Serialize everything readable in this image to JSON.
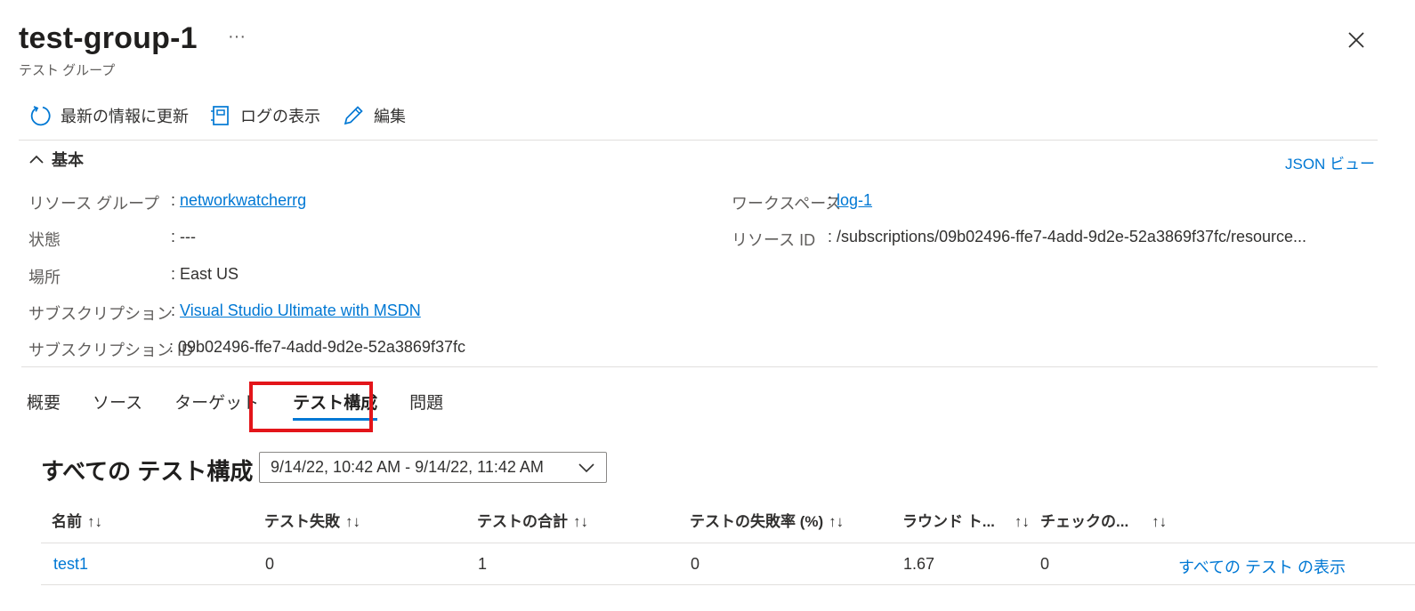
{
  "header": {
    "title": "test-group-1",
    "more_label": "···",
    "subtitle": "テスト グループ"
  },
  "toolbar": {
    "refresh_label": "最新の情報に更新",
    "logs_label": "ログの表示",
    "edit_label": "編集"
  },
  "essentials": {
    "section_label": "基本",
    "json_view_label": "JSON ビュー",
    "left": [
      {
        "label": "リソース グループ",
        "value": "networkwatcherrg"
      },
      {
        "label": "状態",
        "value": "---"
      },
      {
        "label": "場所",
        "value": "East US"
      },
      {
        "label": "サブスクリプション",
        "value": "Visual Studio Ultimate with MSDN"
      },
      {
        "label": "サブスクリプション ID",
        "value": "09b02496-ffe7-4add-9d2e-52a3869f37fc"
      }
    ],
    "right": [
      {
        "label": "ワークスペース",
        "value": "log-1"
      },
      {
        "label": "リソース ID",
        "value": "/subscriptions/09b02496-ffe7-4add-9d2e-52a3869f37fc/resource..."
      }
    ]
  },
  "tabs": [
    "概要",
    "ソース",
    "ターゲット",
    "テスト構成",
    "問題"
  ],
  "active_tab": "テスト構成",
  "test_config": {
    "title": "すべての テスト構成",
    "date_range": "9/14/22, 10:42 AM - 9/14/22, 11:42 AM",
    "columns": [
      "名前",
      "テスト失敗",
      "テストの合計",
      "テストの失敗率 (%)",
      "ラウンド ト...",
      "チェックの..."
    ],
    "sort_glyph": "↑↓",
    "rows": [
      {
        "name": "test1",
        "failed": "0",
        "total": "1",
        "fail_rate": "0",
        "round_trip": "1.67",
        "checks": "0",
        "action": "すべての テスト の表示"
      }
    ]
  },
  "colors": {
    "accent": "#0078d4",
    "highlight_box": "#e3151a",
    "divider": "#e1dfdd"
  }
}
